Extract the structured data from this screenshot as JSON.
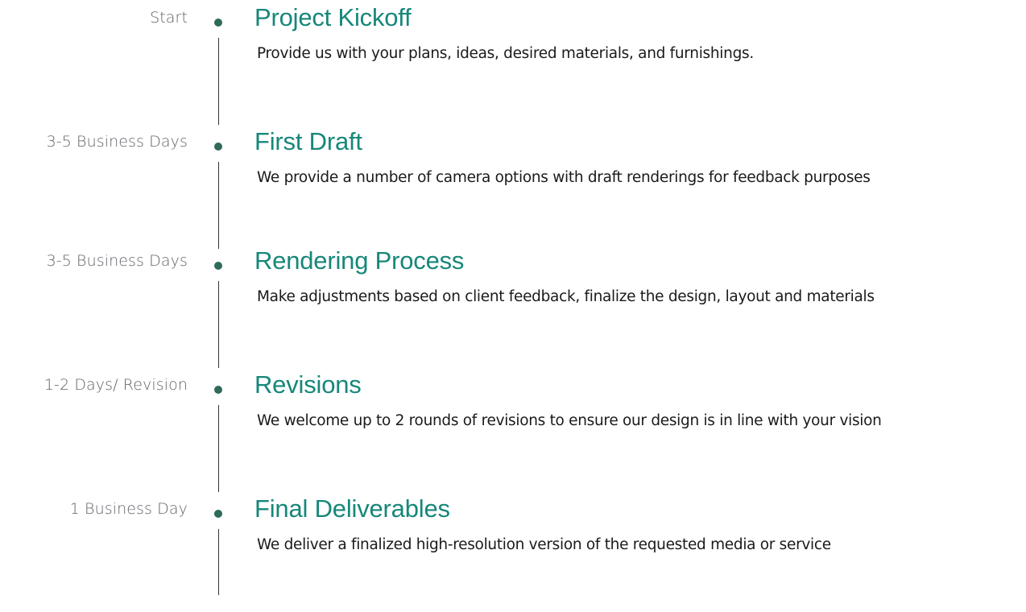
{
  "colors": {
    "title": "#17877a",
    "dot": "#2f6a5a",
    "duration": "#5f6368",
    "description": "#1a1a1a",
    "line": "#333333"
  },
  "steps": [
    {
      "duration": "Start",
      "title": "Project Kickoff",
      "description": "Provide us with your plans, ideas, desired materials, and furnishings."
    },
    {
      "duration": "3-5 Business Days",
      "title": "First Draft",
      "description": "We provide a number of camera options with draft renderings for feedback purposes"
    },
    {
      "duration": "3-5 Business Days",
      "title": "Rendering Process",
      "description": "Make adjustments based on client feedback, finalize the design, layout and materials"
    },
    {
      "duration": "1-2 Days/ Revision",
      "title": "Revisions",
      "description": "We welcome up to 2 rounds of revisions to ensure our design is in line with your vision"
    },
    {
      "duration": "1 Business Day",
      "title": "Final Deliverables",
      "description": "We deliver a finalized high-resolution version of the requested media or service"
    }
  ]
}
